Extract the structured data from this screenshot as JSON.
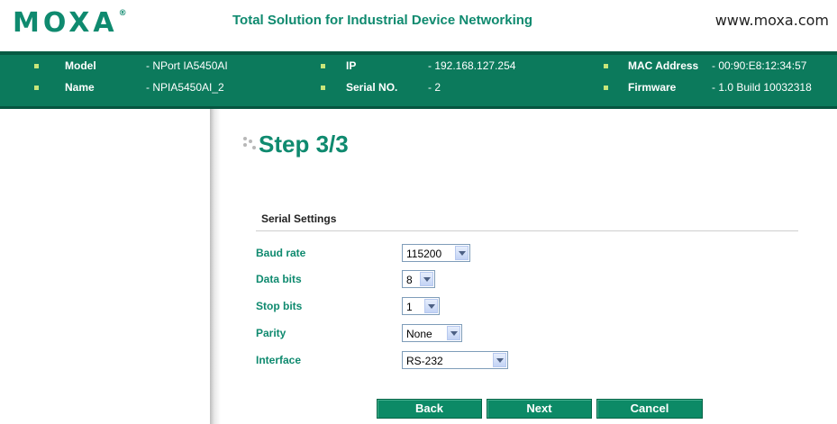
{
  "header": {
    "logo": "MOXA",
    "logo_mark": "®",
    "tagline": "Total Solution for Industrial Device Networking",
    "website": "www.moxa.com"
  },
  "info": {
    "model_label": "Model",
    "model_value": "- NPort IA5450AI",
    "name_label": "Name",
    "name_value": "- NPIA5450AI_2",
    "ip_label": "IP",
    "ip_value": "- 192.168.127.254",
    "serial_label": "Serial NO.",
    "serial_value": "- 2",
    "mac_label": "MAC Address",
    "mac_value": "- 00:90:E8:12:34:57",
    "firmware_label": "Firmware",
    "firmware_value": "- 1.0 Build 10032318"
  },
  "main": {
    "step_title": "Step 3/3",
    "section_title": "Serial Settings",
    "fields": {
      "baud_rate": {
        "label": "Baud rate",
        "value": "115200"
      },
      "data_bits": {
        "label": "Data bits",
        "value": "8"
      },
      "stop_bits": {
        "label": "Stop bits",
        "value": "1"
      },
      "parity": {
        "label": "Parity",
        "value": "None"
      },
      "interface": {
        "label": "Interface",
        "value": "RS-232"
      }
    },
    "buttons": {
      "back": "Back",
      "next": "Next",
      "cancel": "Cancel"
    }
  },
  "colors": {
    "brand_green": "#0f8a6f",
    "infobar_bg": "#0c7a5c",
    "button_bg": "#0c8a66"
  }
}
